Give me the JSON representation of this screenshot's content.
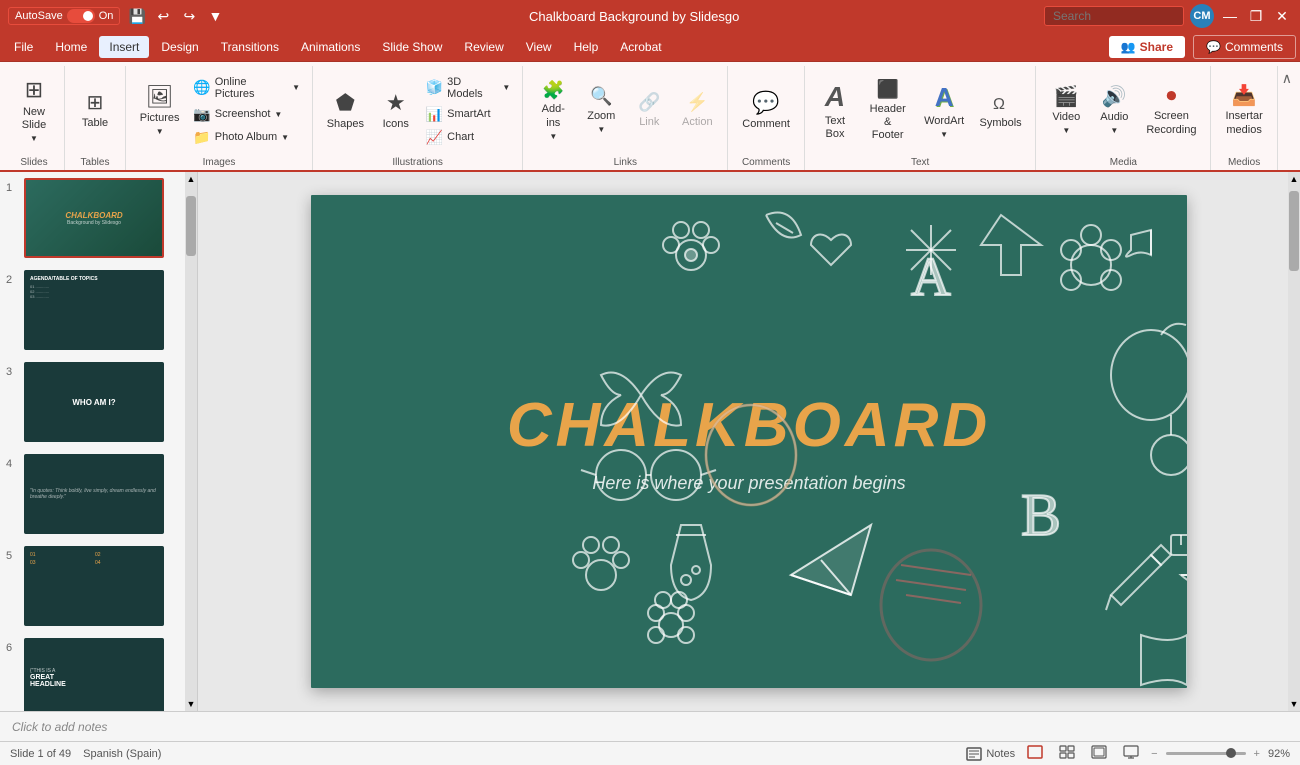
{
  "titleBar": {
    "autosave_label": "AutoSave",
    "autosave_state": "On",
    "title": "Chalkboard Background by Slidesgo",
    "save_icon": "💾",
    "undo_icon": "↩",
    "redo_icon": "↪",
    "customize_icon": "▼",
    "search_placeholder": "Search",
    "profile_initials": "CM",
    "minimize_icon": "—",
    "restore_icon": "❐",
    "close_icon": "✕"
  },
  "menuBar": {
    "items": [
      {
        "label": "File",
        "active": false
      },
      {
        "label": "Home",
        "active": false
      },
      {
        "label": "Insert",
        "active": true
      },
      {
        "label": "Design",
        "active": false
      },
      {
        "label": "Transitions",
        "active": false
      },
      {
        "label": "Animations",
        "active": false
      },
      {
        "label": "Slide Show",
        "active": false
      },
      {
        "label": "Review",
        "active": false
      },
      {
        "label": "View",
        "active": false
      },
      {
        "label": "Help",
        "active": false
      },
      {
        "label": "Acrobat",
        "active": false
      }
    ],
    "share_label": "Share",
    "comments_label": "Comments"
  },
  "ribbon": {
    "groups": [
      {
        "label": "Slides",
        "items": [
          {
            "label": "New\nSlide",
            "icon": "⊞",
            "type": "large"
          }
        ]
      },
      {
        "label": "Tables",
        "items": [
          {
            "label": "Table",
            "icon": "⊞",
            "type": "large"
          }
        ]
      },
      {
        "label": "Images",
        "items": [
          {
            "label": "Pictures",
            "icon": "🖼",
            "type": "large"
          },
          {
            "label": "Online Pictures",
            "icon": "🌐",
            "type": "small"
          },
          {
            "label": "Screenshot",
            "icon": "📷",
            "type": "small"
          },
          {
            "label": "Photo Album",
            "icon": "📁",
            "type": "small"
          }
        ]
      },
      {
        "label": "Illustrations",
        "items": [
          {
            "label": "Shapes",
            "icon": "⬟",
            "type": "large"
          },
          {
            "label": "Icons",
            "icon": "★",
            "type": "large"
          },
          {
            "label": "3D Models",
            "icon": "🧊",
            "type": "small"
          },
          {
            "label": "SmartArt",
            "icon": "📊",
            "type": "small"
          },
          {
            "label": "Chart",
            "icon": "📈",
            "type": "small"
          }
        ]
      },
      {
        "label": "Links",
        "items": [
          {
            "label": "Add-ins",
            "icon": "🧩",
            "type": "large"
          },
          {
            "label": "Zoom",
            "icon": "🔍",
            "type": "large"
          },
          {
            "label": "Link",
            "icon": "🔗",
            "type": "large",
            "disabled": true
          },
          {
            "label": "Action",
            "icon": "⚡",
            "type": "large",
            "disabled": true
          }
        ]
      },
      {
        "label": "Comments",
        "items": [
          {
            "label": "Comment",
            "icon": "💬",
            "type": "large"
          }
        ]
      },
      {
        "label": "Text",
        "items": [
          {
            "label": "Text\nBox",
            "icon": "A",
            "type": "large"
          },
          {
            "label": "Header\n& Footer",
            "icon": "⬜",
            "type": "large"
          },
          {
            "label": "WordArt",
            "icon": "A",
            "type": "large"
          },
          {
            "label": "Symbols",
            "icon": "Ω",
            "type": "large"
          }
        ]
      },
      {
        "label": "Media",
        "items": [
          {
            "label": "Video",
            "icon": "🎬",
            "type": "large"
          },
          {
            "label": "Audio",
            "icon": "🔊",
            "type": "large"
          },
          {
            "label": "Screen\nRecording",
            "icon": "⏺",
            "type": "large"
          }
        ]
      },
      {
        "label": "Medios",
        "items": [
          {
            "label": "Insertar\nmedios",
            "icon": "📥",
            "type": "large"
          }
        ]
      }
    ]
  },
  "slides": [
    {
      "number": "1",
      "selected": true,
      "type": "chalkboard-title"
    },
    {
      "number": "2",
      "selected": false,
      "type": "content"
    },
    {
      "number": "3",
      "selected": false,
      "type": "who-am-i"
    },
    {
      "number": "4",
      "selected": false,
      "type": "quote"
    },
    {
      "number": "5",
      "selected": false,
      "type": "numbers"
    },
    {
      "number": "6",
      "selected": false,
      "type": "headline"
    }
  ],
  "slideCanvas": {
    "title": "CHALKBOARD",
    "subtitle": "Here is where your presentation begins",
    "background_color": "#2c6b5e"
  },
  "notesBar": {
    "placeholder": "Click to add notes"
  },
  "statusBar": {
    "slide_info": "Slide 1 of 49",
    "language": "Spanish (Spain)",
    "notes_label": "Notes",
    "zoom_percent": "92%",
    "zoom_minus": "−",
    "zoom_plus": "+"
  }
}
